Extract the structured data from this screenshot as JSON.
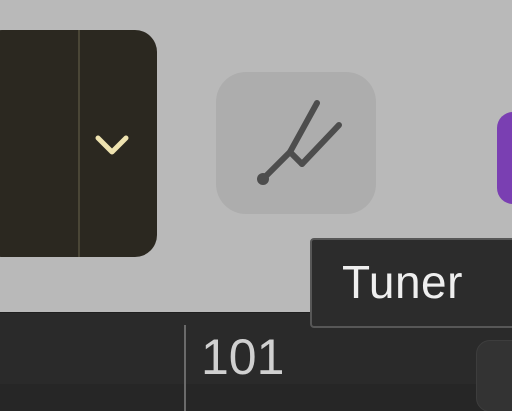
{
  "tooltip": {
    "text": "Tuner"
  },
  "ruler": {
    "bar_number": "101"
  },
  "icons": {
    "tuner": "tuning-fork-icon",
    "dropdown": "chevron-down-icon"
  },
  "colors": {
    "toolbar_background": "#b9b9b9",
    "lcd_background": "#2b2820",
    "chevron": "#efe3b0",
    "tuner_button": "#adadad",
    "purple_button": "#7a3fb2",
    "tooltip_background": "#2c2c2c",
    "ruler_background": "#2a2a2a"
  }
}
